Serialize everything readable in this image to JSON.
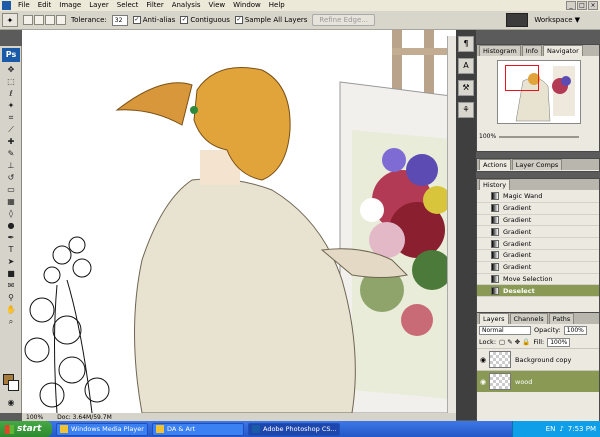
{
  "menu": [
    "File",
    "Edit",
    "Image",
    "Layer",
    "Select",
    "Filter",
    "Analysis",
    "View",
    "Window",
    "Help"
  ],
  "options": {
    "tolerance_label": "Tolerance:",
    "tolerance_value": "32",
    "anti_alias": "Anti-alias",
    "contiguous": "Contiguous",
    "sample_all_layers": "Sample All Layers",
    "refine_edge": "Refine Edge...",
    "workspace": "Workspace"
  },
  "canvas": {
    "zoom": "100%",
    "doc_info": "Doc: 3.64M/59.7M"
  },
  "panels": {
    "nav_tabs": [
      "Histogram",
      "Info",
      "Navigator"
    ],
    "nav_zoom": "100%",
    "action_tabs": [
      "Actions",
      "Layer Comps"
    ],
    "history_tab": "History",
    "history_items": [
      "Magic Wand",
      "Gradient",
      "Gradient",
      "Gradient",
      "Gradient",
      "Gradient",
      "Gradient",
      "Move Selection",
      "Deselect"
    ],
    "layer_tabs": [
      "Layers",
      "Channels",
      "Paths"
    ],
    "blend_mode": "Normal",
    "opacity_label": "Opacity:",
    "opacity": "100%",
    "lock_label": "Lock:",
    "fill_label": "Fill:",
    "fill": "100%",
    "layers": [
      "Background copy",
      "wood"
    ]
  },
  "taskbar": {
    "start": "start",
    "tasks": [
      "Windows Media Player",
      "DA & Art",
      "Adobe Photoshop CS..."
    ],
    "lang": "EN",
    "time": "7:53 PM"
  },
  "colors": {
    "accent_selected": "#8a9a54",
    "ps_blue": "#1b5aa6",
    "taskbar": "#2457c8"
  }
}
